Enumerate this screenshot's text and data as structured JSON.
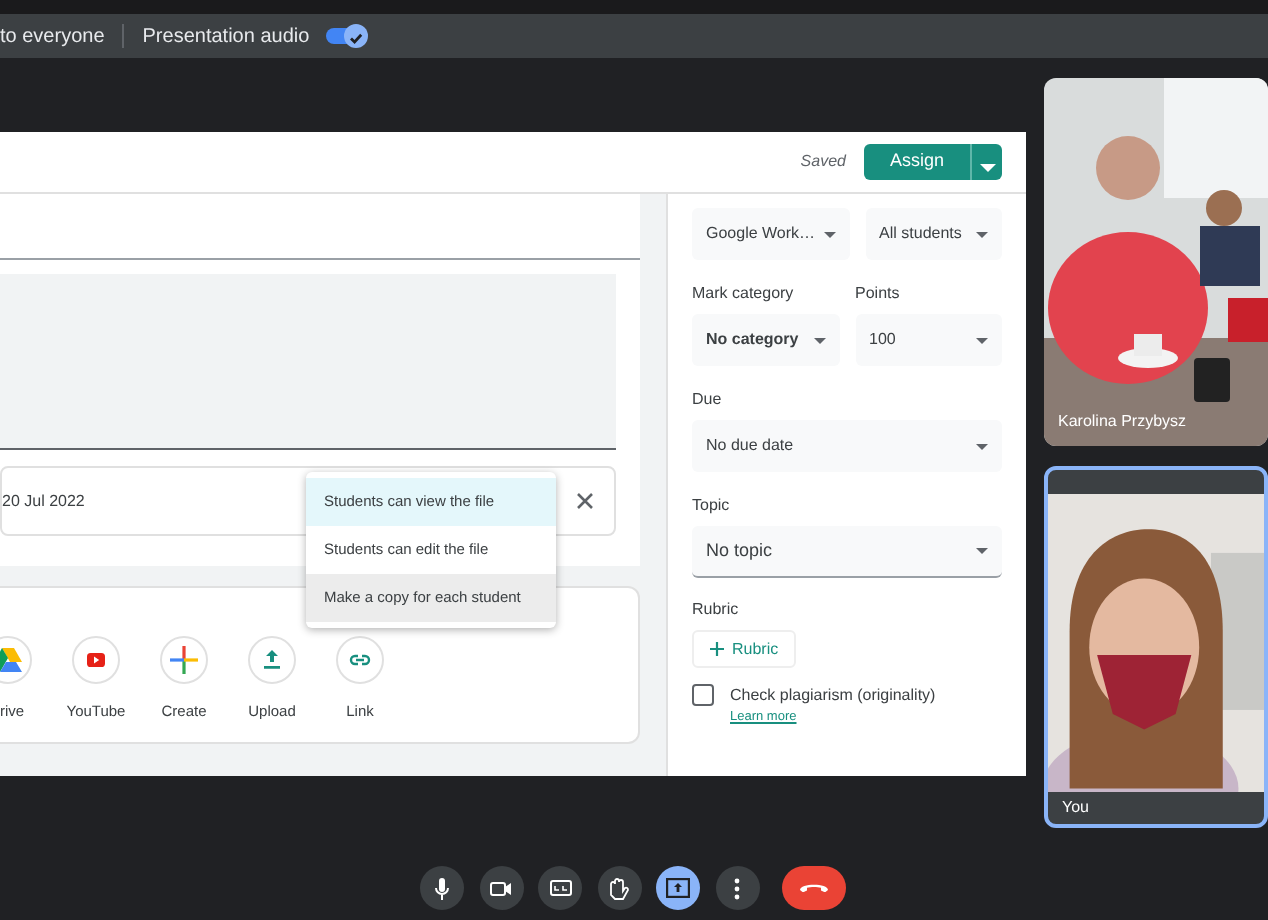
{
  "share_bar": {
    "audience": "to everyone",
    "audio_label": "Presentation audio",
    "audio_on": true
  },
  "assignment": {
    "status": "Saved",
    "assign_button": "Assign",
    "attachment_date": "20 Jul 2022",
    "share_menu": [
      {
        "label": "Students can view the file",
        "selected": true,
        "hovered": false
      },
      {
        "label": "Students can edit the file",
        "selected": false,
        "hovered": false
      },
      {
        "label": "Make a copy for each student",
        "selected": false,
        "hovered": true
      }
    ],
    "add_buttons": [
      {
        "kind": "drive",
        "label": "rive"
      },
      {
        "kind": "youtube",
        "label": "YouTube"
      },
      {
        "kind": "create",
        "label": "Create"
      },
      {
        "kind": "upload",
        "label": "Upload"
      },
      {
        "kind": "link",
        "label": "Link"
      }
    ]
  },
  "settings": {
    "for_selects": [
      {
        "value": "Google Work…"
      },
      {
        "value": "All students"
      }
    ],
    "mark_category": {
      "label": "Mark category",
      "value": "No category"
    },
    "points": {
      "label": "Points",
      "value": "100"
    },
    "due": {
      "label": "Due",
      "value": "No due date"
    },
    "topic": {
      "label": "Topic",
      "value": "No topic"
    },
    "rubric": {
      "label": "Rubric",
      "button": "Rubric"
    },
    "plagiarism": {
      "label": "Check plagiarism (originality)",
      "checked": false,
      "link": "Learn more"
    }
  },
  "participants": [
    {
      "name": "Karolina Przybysz",
      "self": false
    },
    {
      "name": "You",
      "self": true
    }
  ],
  "controls": [
    {
      "kind": "mic",
      "selected": false
    },
    {
      "kind": "camera",
      "selected": false
    },
    {
      "kind": "captions",
      "selected": false
    },
    {
      "kind": "hand",
      "selected": false
    },
    {
      "kind": "present",
      "selected": true
    },
    {
      "kind": "more",
      "selected": false
    },
    {
      "kind": "hangup",
      "selected": false
    }
  ]
}
